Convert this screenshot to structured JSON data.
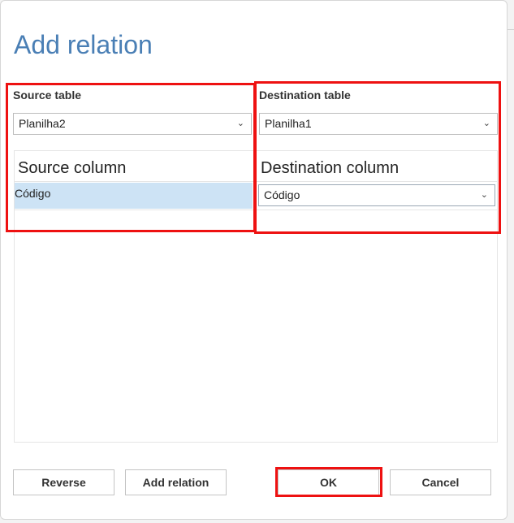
{
  "dialog": {
    "title": "Add relation"
  },
  "source": {
    "label": "Source table",
    "table_value": "Planilha2",
    "column_header": "Source column",
    "column_value": "Código"
  },
  "destination": {
    "label": "Destination table",
    "table_value": "Planilha1",
    "column_header": "Destination column",
    "column_value": "Código"
  },
  "buttons": {
    "reverse": "Reverse",
    "add_relation": "Add relation",
    "ok": "OK",
    "cancel": "Cancel"
  },
  "icons": {
    "dropdown": "chevron-down-icon"
  },
  "colors": {
    "title": "#4a7fb5",
    "selection": "#cde3f5",
    "highlight_annotation": "#ee1111"
  }
}
